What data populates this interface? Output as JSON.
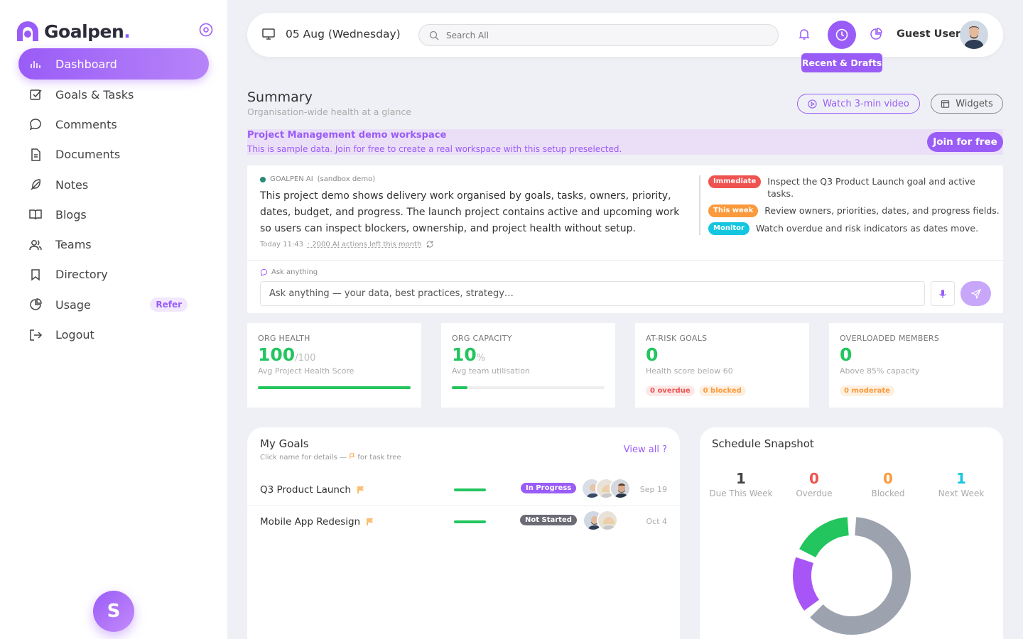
{
  "brand": {
    "name": "Goalpen",
    "accent": "#9a5cf7"
  },
  "sidebar": {
    "items": [
      {
        "label": "Dashboard",
        "icon": "bar-chart-icon",
        "active": true
      },
      {
        "label": "Goals & Tasks",
        "icon": "checkbox-icon"
      },
      {
        "label": "Comments",
        "icon": "chat-bubble-icon"
      },
      {
        "label": "Documents",
        "icon": "document-icon"
      },
      {
        "label": "Notes",
        "icon": "feather-icon"
      },
      {
        "label": "Blogs",
        "icon": "book-icon"
      },
      {
        "label": "Teams",
        "icon": "users-icon"
      },
      {
        "label": "Directory",
        "icon": "bookmark-icon"
      },
      {
        "label": "Usage",
        "icon": "pie-chart-icon",
        "badge": "Refer"
      },
      {
        "label": "Logout",
        "icon": "logout-icon"
      }
    ],
    "fab_label": "S"
  },
  "topbar": {
    "date": "05 Aug (Wednesday)",
    "search_placeholder": "Search All",
    "user_name": "Guest User",
    "tooltip": "Recent & Drafts"
  },
  "summary": {
    "title": "Summary",
    "subtitle": "Organisation-wide health at a glance",
    "watch_label": "Watch 3-min video",
    "widgets_label": "Widgets"
  },
  "demo": {
    "title": "Project Management demo workspace",
    "desc": "This is sample data. Join for free to create a real workspace with this setup preselected.",
    "join_label": "Join for free"
  },
  "ai": {
    "tag": "GOALPEN AI",
    "tag_note": "(sandbox demo)",
    "text": "This project demo shows delivery work organised by goals, tasks, owners, priority, dates, budget, and progress. The launch project contains active and upcoming work so users can inspect blockers, ownership, and project health without setup.",
    "time": "Today 11:43",
    "actions_left": "· 2000 AI actions left this month",
    "priorities": [
      {
        "badge": "Immediate",
        "color": "#ef5350",
        "text": "Inspect the Q3 Product Launch goal and active tasks."
      },
      {
        "badge": "This week",
        "color": "#fb9a3c",
        "text": "Review owners, priorities, dates, and progress fields."
      },
      {
        "badge": "Monitor",
        "color": "#14c6e0",
        "text": "Watch overdue and risk indicators as dates move."
      }
    ],
    "ask_label": "Ask anything",
    "ask_placeholder": "Ask anything — your data, best practices, strategy…"
  },
  "stats": [
    {
      "label": "ORG HEALTH",
      "value": "100",
      "unit": "/100",
      "sub": "Avg Project Health Score",
      "progress": 1.0
    },
    {
      "label": "ORG CAPACITY",
      "value": "10",
      "unit": "%",
      "sub": "Avg team utilisation",
      "progress": 0.1
    },
    {
      "label": "AT-RISK GOALS",
      "value": "0",
      "unit": "",
      "sub": "Health score below 60",
      "chips": [
        "0 overdue",
        "0 blocked"
      ]
    },
    {
      "label": "OVERLOADED MEMBERS",
      "value": "0",
      "unit": "",
      "sub": "Above 85% capacity",
      "chips": [
        "0 moderate"
      ]
    }
  ],
  "goals": {
    "title": "My Goals",
    "subtitle_a": "Click name for details —",
    "subtitle_b": "for task tree",
    "view_all": "View all ?",
    "rows": [
      {
        "name": "Q3 Product Launch",
        "status": "In Progress",
        "status_color": "#9a5cf7",
        "date": "Sep 19"
      },
      {
        "name": "Mobile App Redesign",
        "status": "Not Started",
        "status_color": "#6b6b76",
        "date": "Oct 4"
      }
    ]
  },
  "schedule": {
    "title": "Schedule Snapshot",
    "stats": [
      {
        "num": "1",
        "label": "Due This Week",
        "color": "#444"
      },
      {
        "num": "0",
        "label": "Overdue",
        "color": "#ef5350"
      },
      {
        "num": "0",
        "label": "Blocked",
        "color": "#fb9a3c"
      },
      {
        "num": "1",
        "label": "Next Week",
        "color": "#14c6e0"
      }
    ],
    "donut": [
      {
        "value": 0.58,
        "color": "#9ca3af"
      },
      {
        "value": 0.16,
        "color": "#a855f7"
      },
      {
        "value": 0.17,
        "color": "#22c55e"
      }
    ]
  }
}
